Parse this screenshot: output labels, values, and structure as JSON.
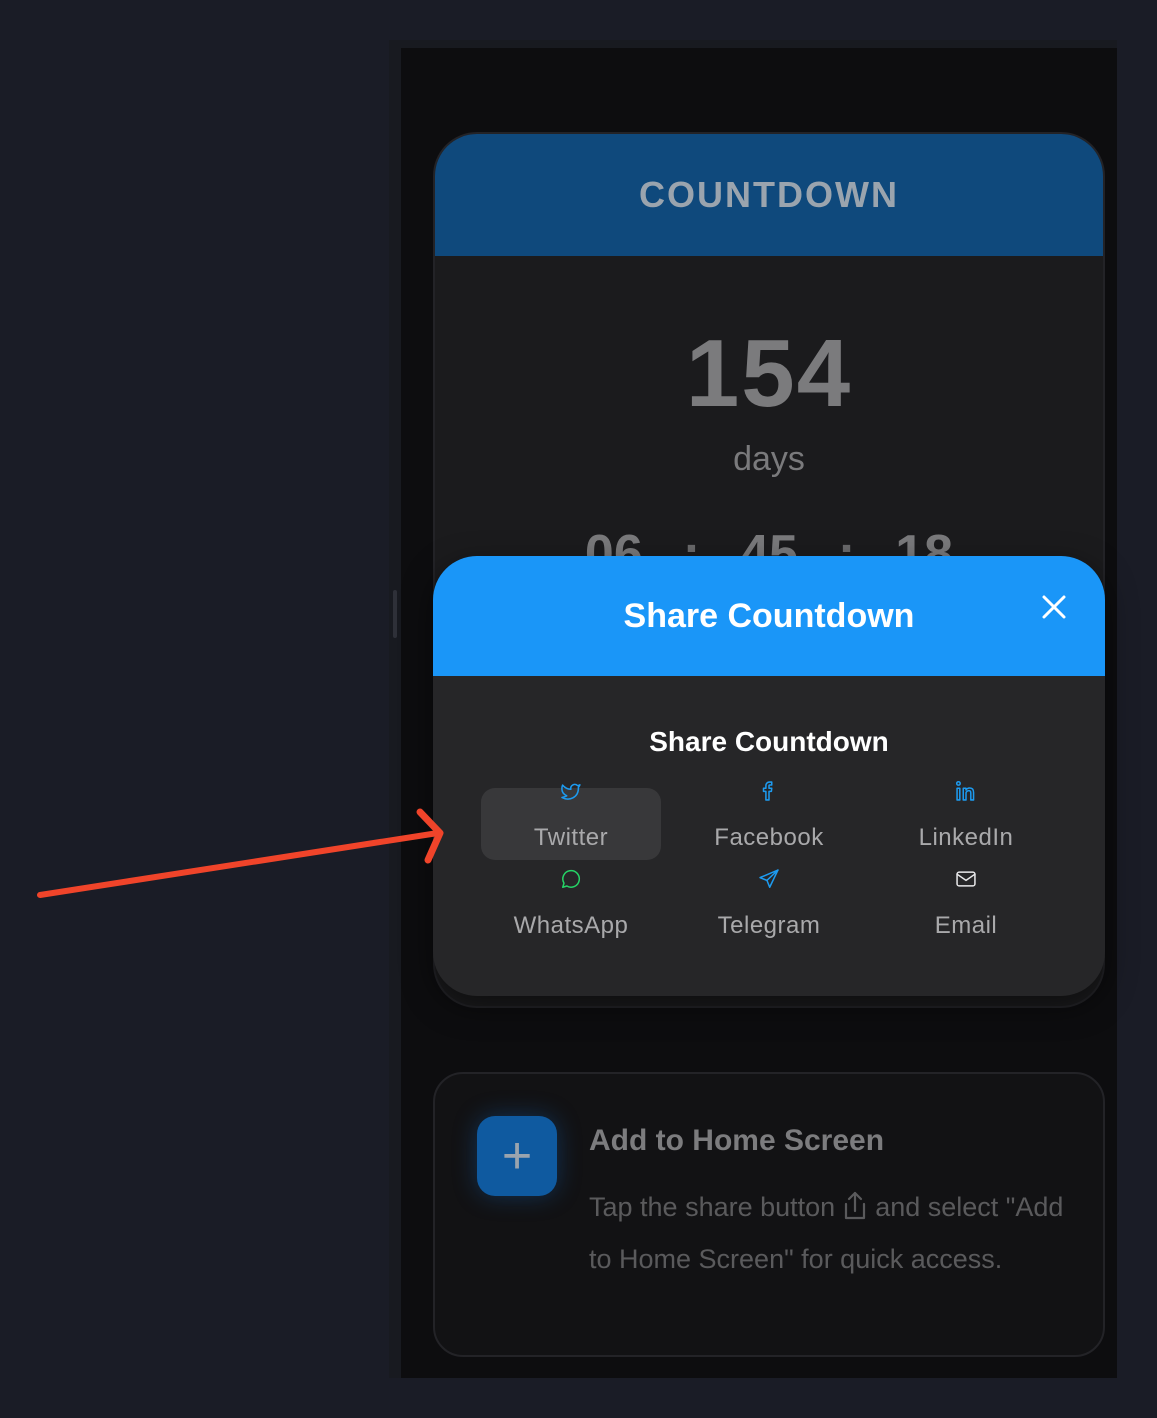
{
  "countdown": {
    "header_title": "COUNTDOWN",
    "days": "154",
    "days_label": "days",
    "hours": "06",
    "minutes": "45",
    "seconds": "18",
    "separator": ":"
  },
  "share_modal": {
    "title": "Share Countdown",
    "subtitle": "Share Countdown",
    "options": [
      {
        "label": "Twitter",
        "icon": "twitter-icon",
        "color": "#1d9bf0"
      },
      {
        "label": "Facebook",
        "icon": "facebook-icon",
        "color": "#1d9bf0"
      },
      {
        "label": "LinkedIn",
        "icon": "linkedin-icon",
        "color": "#1d9bf0"
      },
      {
        "label": "WhatsApp",
        "icon": "whatsapp-icon",
        "color": "#25d366"
      },
      {
        "label": "Telegram",
        "icon": "telegram-icon",
        "color": "#1d9bf0"
      },
      {
        "label": "Email",
        "icon": "email-icon",
        "color": "#e8e8ea"
      }
    ]
  },
  "home_card": {
    "title": "Add to Home Screen",
    "desc_before": "Tap the share button",
    "desc_after": "and select \"Add to Home Screen\" for quick access.",
    "plus": "+"
  },
  "colors": {
    "modal_header": "#1a96f8",
    "countdown_header": "#0f497c",
    "annotation_arrow": "#f0442a"
  }
}
